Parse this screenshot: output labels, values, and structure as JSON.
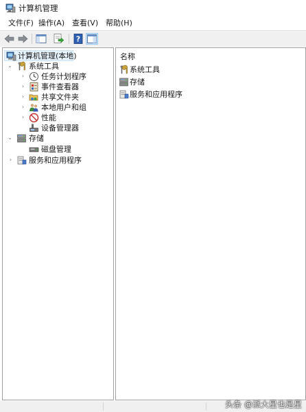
{
  "window": {
    "title": "计算机管理"
  },
  "menu": [
    "文件(F)",
    "操作(A)",
    "查看(V)",
    "帮助(H)"
  ],
  "toolbar": {
    "buttons": [
      {
        "icon": "back-arrow-icon"
      },
      {
        "icon": "forward-arrow-icon"
      },
      {
        "icon": "show-hide-console-tree-icon"
      },
      {
        "icon": "export-list-icon"
      },
      {
        "icon": "help-icon"
      },
      {
        "icon": "show-hide-action-pane-icon"
      }
    ]
  },
  "tree": {
    "root": {
      "label": "计算机管理(本地)",
      "icon": "computer-management-icon"
    },
    "items": [
      {
        "label": "系统工具",
        "icon": "system-tools-icon",
        "level": 1,
        "expanded": true
      },
      {
        "label": "任务计划程序",
        "icon": "task-scheduler-icon",
        "level": 2,
        "expandable": true
      },
      {
        "label": "事件查看器",
        "icon": "event-viewer-icon",
        "level": 2,
        "expandable": true
      },
      {
        "label": "共享文件夹",
        "icon": "shared-folders-icon",
        "level": 2,
        "expandable": true
      },
      {
        "label": "本地用户和组",
        "icon": "local-users-groups-icon",
        "level": 2,
        "expandable": true
      },
      {
        "label": "性能",
        "icon": "performance-icon",
        "level": 2,
        "expandable": true
      },
      {
        "label": "设备管理器",
        "icon": "device-manager-icon",
        "level": 2,
        "expandable": false
      },
      {
        "label": "存储",
        "icon": "storage-icon",
        "level": 1,
        "expanded": true
      },
      {
        "label": "磁盘管理",
        "icon": "disk-management-icon",
        "level": 2,
        "expandable": false
      },
      {
        "label": "服务和应用程序",
        "icon": "services-applications-icon",
        "level": 1,
        "expanded": false
      }
    ]
  },
  "list": {
    "column_header": "名称",
    "rows": [
      {
        "label": "系统工具",
        "icon": "system-tools-icon"
      },
      {
        "label": "存储",
        "icon": "storage-icon"
      },
      {
        "label": "服务和应用程序",
        "icon": "services-applications-icon"
      }
    ]
  },
  "watermark": "头条 @派大星也是星",
  "colors": {
    "selection_bg": "#e5f1fb",
    "selection_border": "#cce4f7",
    "toolbar_bg": "#f0f0f0",
    "pane_border": "#a0a0a0"
  }
}
